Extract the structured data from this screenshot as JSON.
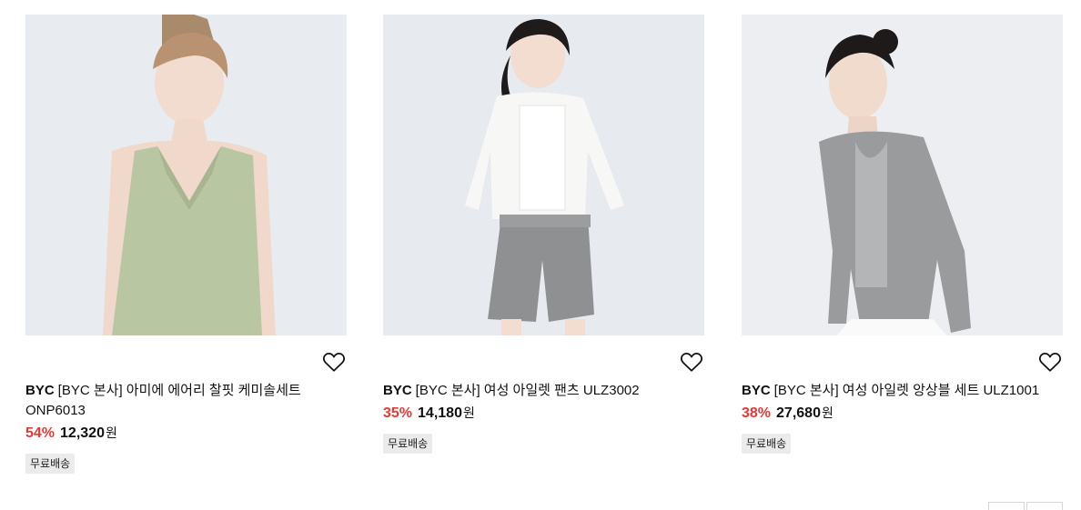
{
  "products": [
    {
      "brand": "BYC",
      "title": "[BYC 본사] 아미에 에어리 찰핏 케미솔세트 ONP6013",
      "discount": "54%",
      "price": "12,320",
      "currency": "원",
      "badge": "무료배송",
      "image_bg": "#e8ecf0",
      "garment_color": "#b9c6a2"
    },
    {
      "brand": "BYC",
      "title": "[BYC 본사] 여성 아일렛 팬츠 ULZ3002",
      "discount": "35%",
      "price": "14,180",
      "currency": "원",
      "badge": "무료배송",
      "image_bg": "#e7eaee",
      "garment_color": "#8f9092"
    },
    {
      "brand": "BYC",
      "title": "[BYC 본사] 여성 아일렛 앙상블 세트 ULZ1001",
      "discount": "38%",
      "price": "27,680",
      "currency": "원",
      "badge": "무료배송",
      "image_bg": "#eceef1",
      "garment_color": "#9a9b9d"
    }
  ],
  "icons": {
    "wishlist": "heart-outline-icon"
  },
  "colors": {
    "discount": "#e53935",
    "badge_bg": "#ebebeb"
  }
}
